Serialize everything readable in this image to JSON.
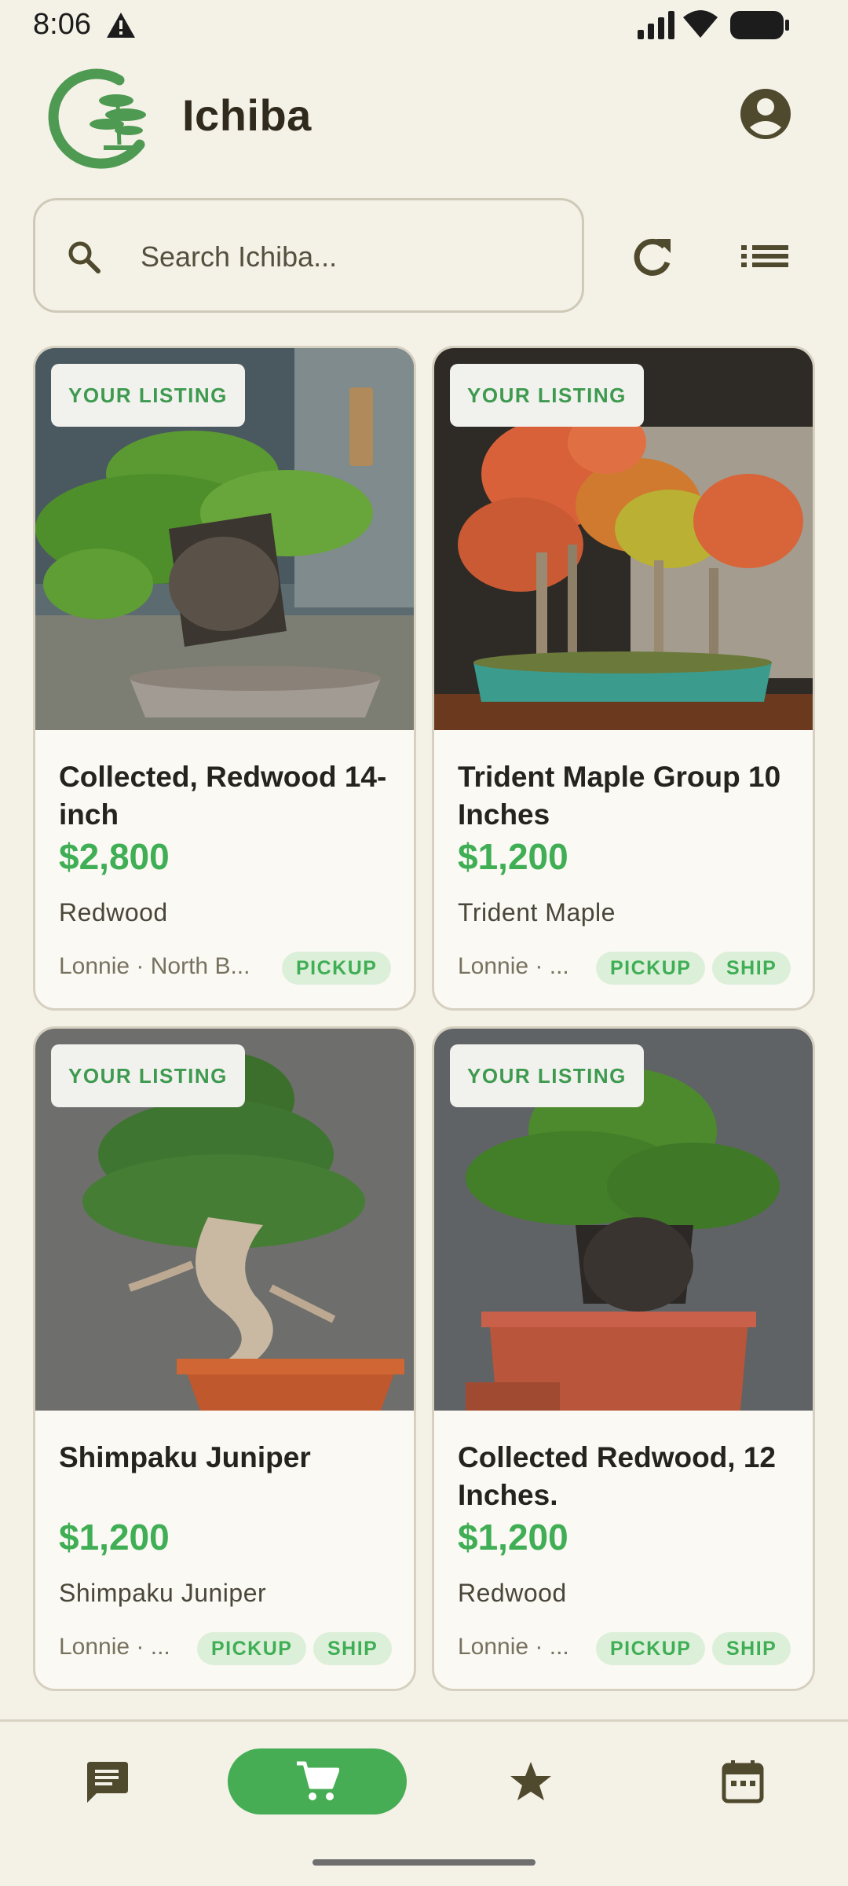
{
  "status_bar": {
    "time": "8:06"
  },
  "header": {
    "title": "Ichiba"
  },
  "search": {
    "placeholder": "Search Ichiba..."
  },
  "listings": [
    {
      "badge": "YOUR LISTING",
      "title": "Collected, Redwood 14-inch",
      "price": "$2,800",
      "species": "Redwood",
      "seller": "Lonnie · North B...",
      "tags": [
        "PICKUP"
      ]
    },
    {
      "badge": "YOUR LISTING",
      "title": "Trident Maple Group 10 Inches",
      "price": "$1,200",
      "species": "Trident Maple",
      "seller": "Lonnie · ...",
      "tags": [
        "PICKUP",
        "SHIP"
      ]
    },
    {
      "badge": "YOUR LISTING",
      "title": "Shimpaku Juniper",
      "price": "$1,200",
      "species": "Shimpaku Juniper",
      "seller": "Lonnie · ...",
      "tags": [
        "PICKUP",
        "SHIP"
      ]
    },
    {
      "badge": "YOUR LISTING",
      "title": "Collected Redwood, 12 Inches.",
      "price": "$1,200",
      "species": "Redwood",
      "seller": "Lonnie · ...",
      "tags": [
        "PICKUP",
        "SHIP"
      ]
    }
  ],
  "bottom_nav": {
    "items": [
      "messages-icon",
      "cart-icon",
      "star-icon",
      "calendar-icon"
    ],
    "active": "cart-icon"
  },
  "colors": {
    "accent": "#3fae55",
    "background": "#f4f1e7",
    "icon": "#4f4a2e"
  }
}
